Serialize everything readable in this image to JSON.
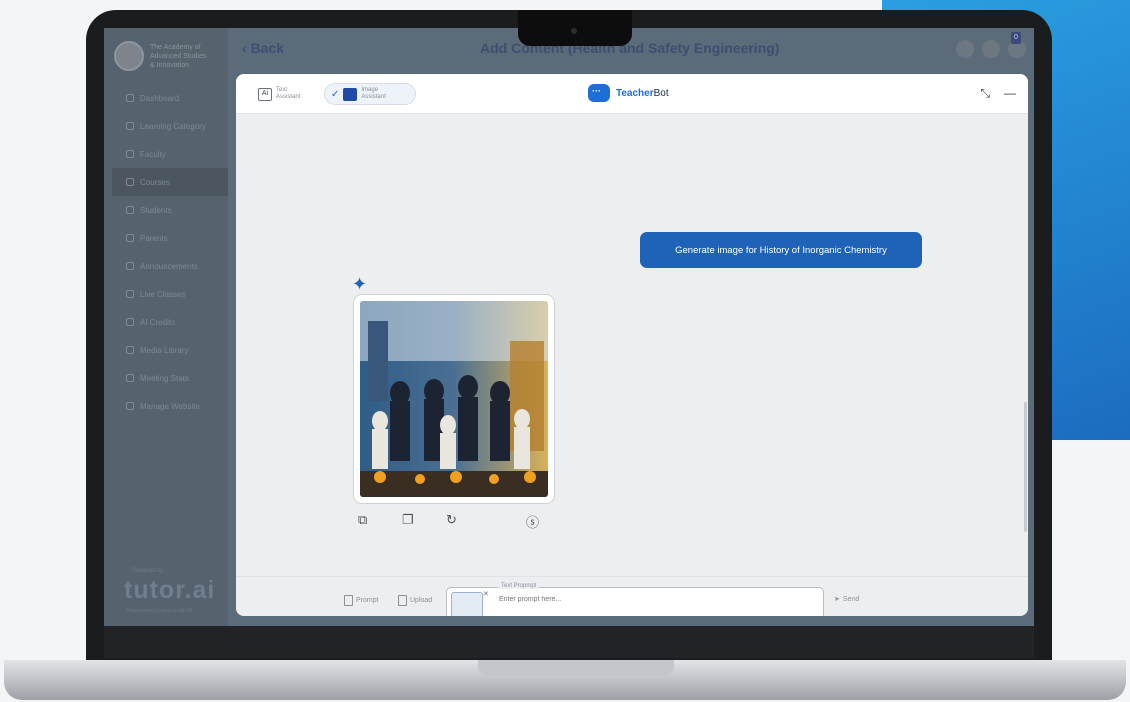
{
  "org": {
    "name_line1": "The Academy of",
    "name_line2": "Advanced Studies",
    "name_line3": "& Innovation"
  },
  "header": {
    "back_label": "Back",
    "title": "Add Content (Health and Safety Engineering)",
    "notification_count": "0"
  },
  "sidebar": {
    "items": [
      {
        "label": "Dashboard",
        "icon": "dashboard-icon"
      },
      {
        "label": "Learning Category",
        "icon": "category-icon"
      },
      {
        "label": "Faculty",
        "icon": "faculty-icon"
      },
      {
        "label": "Courses",
        "icon": "courses-icon",
        "active": true
      },
      {
        "label": "Students",
        "icon": "students-icon"
      },
      {
        "label": "Parents",
        "icon": "parents-icon"
      },
      {
        "label": "Announcements",
        "icon": "announcements-icon"
      },
      {
        "label": "Live Classes",
        "icon": "live-classes-icon"
      },
      {
        "label": "AI Credits",
        "icon": "ai-credits-icon"
      },
      {
        "label": "Media Library",
        "icon": "media-library-icon"
      },
      {
        "label": "Meeting Stats",
        "icon": "meeting-stats-icon"
      },
      {
        "label": "Manage Website",
        "icon": "manage-website-icon"
      }
    ],
    "powered_by": "Powered by",
    "brand_logo": "tutor.ai",
    "brand_tagline": "Personalized Learning with AI"
  },
  "modal": {
    "tabs": [
      {
        "label_line1": "Text",
        "label_line2": "Assistant",
        "icon": "text-assistant-icon"
      },
      {
        "label_line1": "Image",
        "label_line2": "Assistant",
        "icon": "image-assistant-icon",
        "selected": true
      }
    ],
    "bot_name_part1": "Teacher",
    "bot_name_part2": "Bot",
    "actions": {
      "minimize_icon": "minimize-icon",
      "collapse_icon": "collapse-icon"
    }
  },
  "chat": {
    "user_message": "Generate image for History of Inorganic Chemistry",
    "ai_response_icon": "sparkle-icon",
    "image_actions": [
      "copy-icon",
      "duplicate-icon",
      "regenerate-icon",
      "credits-icon"
    ]
  },
  "footer": {
    "prompt_label": "Prompt",
    "upload_label": "Upload",
    "prompt_legend": "Text Propmpt",
    "prompt_placeholder": "Enter prompt here...",
    "send_label": "Send"
  },
  "colors": {
    "accent": "#1e63b8",
    "bot_blue": "#1f6ed4",
    "dim_bg": "#5b6b79",
    "side_panel": "#2a9fe0"
  }
}
